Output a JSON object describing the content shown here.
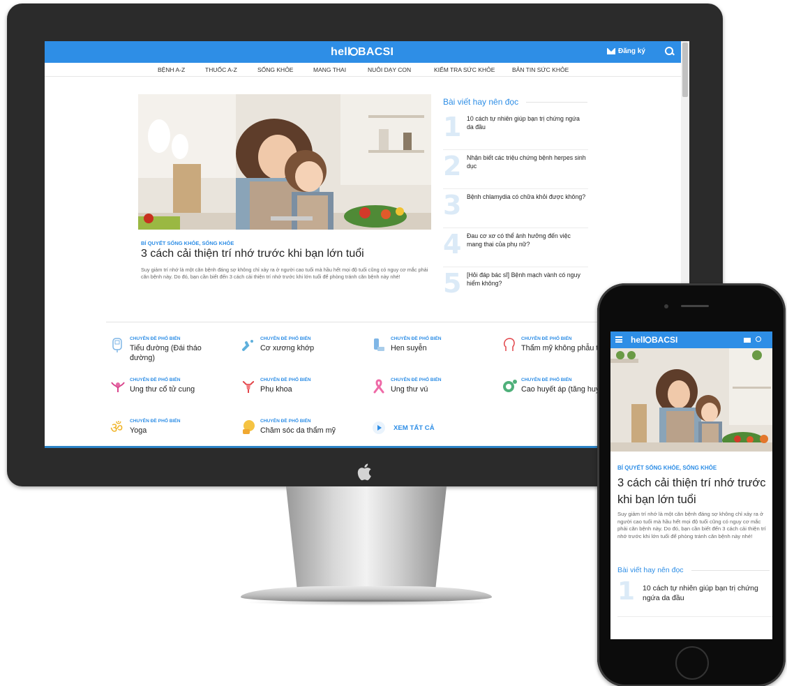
{
  "brand": {
    "logo": "hellobacsi_logo",
    "logo_text": "hello BACSI",
    "accent": "#2e8ee6"
  },
  "header": {
    "signup_label": "Đăng ký",
    "nav": [
      "BỆNH A-Z",
      "THUỐC A-Z",
      "SỐNG KHỎE",
      "MANG THAI",
      "NUÔI DẠY CON",
      "KIỂM TRA SỨC KHỎE",
      "BẢN TIN SỨC KHỎE"
    ]
  },
  "hero": {
    "category": "BÍ QUYẾT SỐNG KHỎE, SỐNG KHỎE",
    "title": "3 cách cải thiện trí nhớ trước khi bạn lớn tuổi",
    "description": "Suy giảm trí nhớ là một căn bệnh đáng sợ không chỉ xảy ra ở người cao tuổi mà hầu hết mọi độ tuổi cũng có nguy cơ mắc phải căn bệnh này. Do đó, bạn cần biết đến 3 cách cải thiện trí nhớ trước khi lớn tuổi để phòng tránh căn bệnh này nhé!"
  },
  "must_read": {
    "title": "Bài viết hay nên đọc",
    "items": [
      {
        "num": "1",
        "text": "10 cách tự nhiên giúp bạn trị chứng ngứa da đầu"
      },
      {
        "num": "2",
        "text": "Nhận biết các triệu chứng bệnh herpes sinh dục"
      },
      {
        "num": "3",
        "text": "Bệnh chlamydia có chữa khỏi được không?"
      },
      {
        "num": "4",
        "text": "Đau cơ xơ có thể ảnh hưởng đến việc mang thai của phụ nữ?"
      },
      {
        "num": "5",
        "text": "[Hỏi đáp bác sĩ] Bệnh mạch vành có nguy hiểm không?"
      }
    ]
  },
  "topics": {
    "category_label": "CHUYÊN ĐỀ PHỔ BIẾN",
    "items": [
      {
        "name": "Tiểu đường (Đái tháo đường)",
        "icon": "glucose-meter-icon"
      },
      {
        "name": "Cơ xương khớp",
        "icon": "joint-icon"
      },
      {
        "name": "Hen suyễn",
        "icon": "inhaler-icon"
      },
      {
        "name": "Thẩm mỹ không phẫu thuật",
        "icon": "face-icon"
      },
      {
        "name": "Ung thư cổ tử cung",
        "icon": "cervical-icon"
      },
      {
        "name": "Phụ khoa",
        "icon": "uterus-icon"
      },
      {
        "name": "Ung thư vú",
        "icon": "pink-ribbon-icon"
      },
      {
        "name": "Cao huyết áp (tăng huyết áp)",
        "icon": "blood-pressure-icon"
      },
      {
        "name": "Yoga",
        "icon": "om-icon"
      },
      {
        "name": "Chăm sóc da thẩm mỹ",
        "icon": "skin-care-icon"
      }
    ],
    "see_all": "XEM TẤT CẢ"
  },
  "mobile": {
    "category": "BÍ QUYẾT SỐNG KHỎE, SỐNG KHỎE",
    "title": "3 cách cải thiện trí nhớ trước khi bạn lớn tuổi",
    "description": "Suy giảm trí nhớ là một căn bệnh đáng sợ không chỉ xảy ra ở người cao tuổi mà hầu hết mọi độ tuổi cũng có nguy cơ mắc phải căn bệnh này. Do đó, bạn cần biết đến 3 cách cải thiện trí nhớ trước khi lớn tuổi để phòng tránh căn bệnh này nhé!",
    "must_read_title": "Bài viết hay nên đọc",
    "first_item_num": "1",
    "first_item": "10 cách tự nhiên giúp bạn trị chứng ngứa da đầu"
  }
}
